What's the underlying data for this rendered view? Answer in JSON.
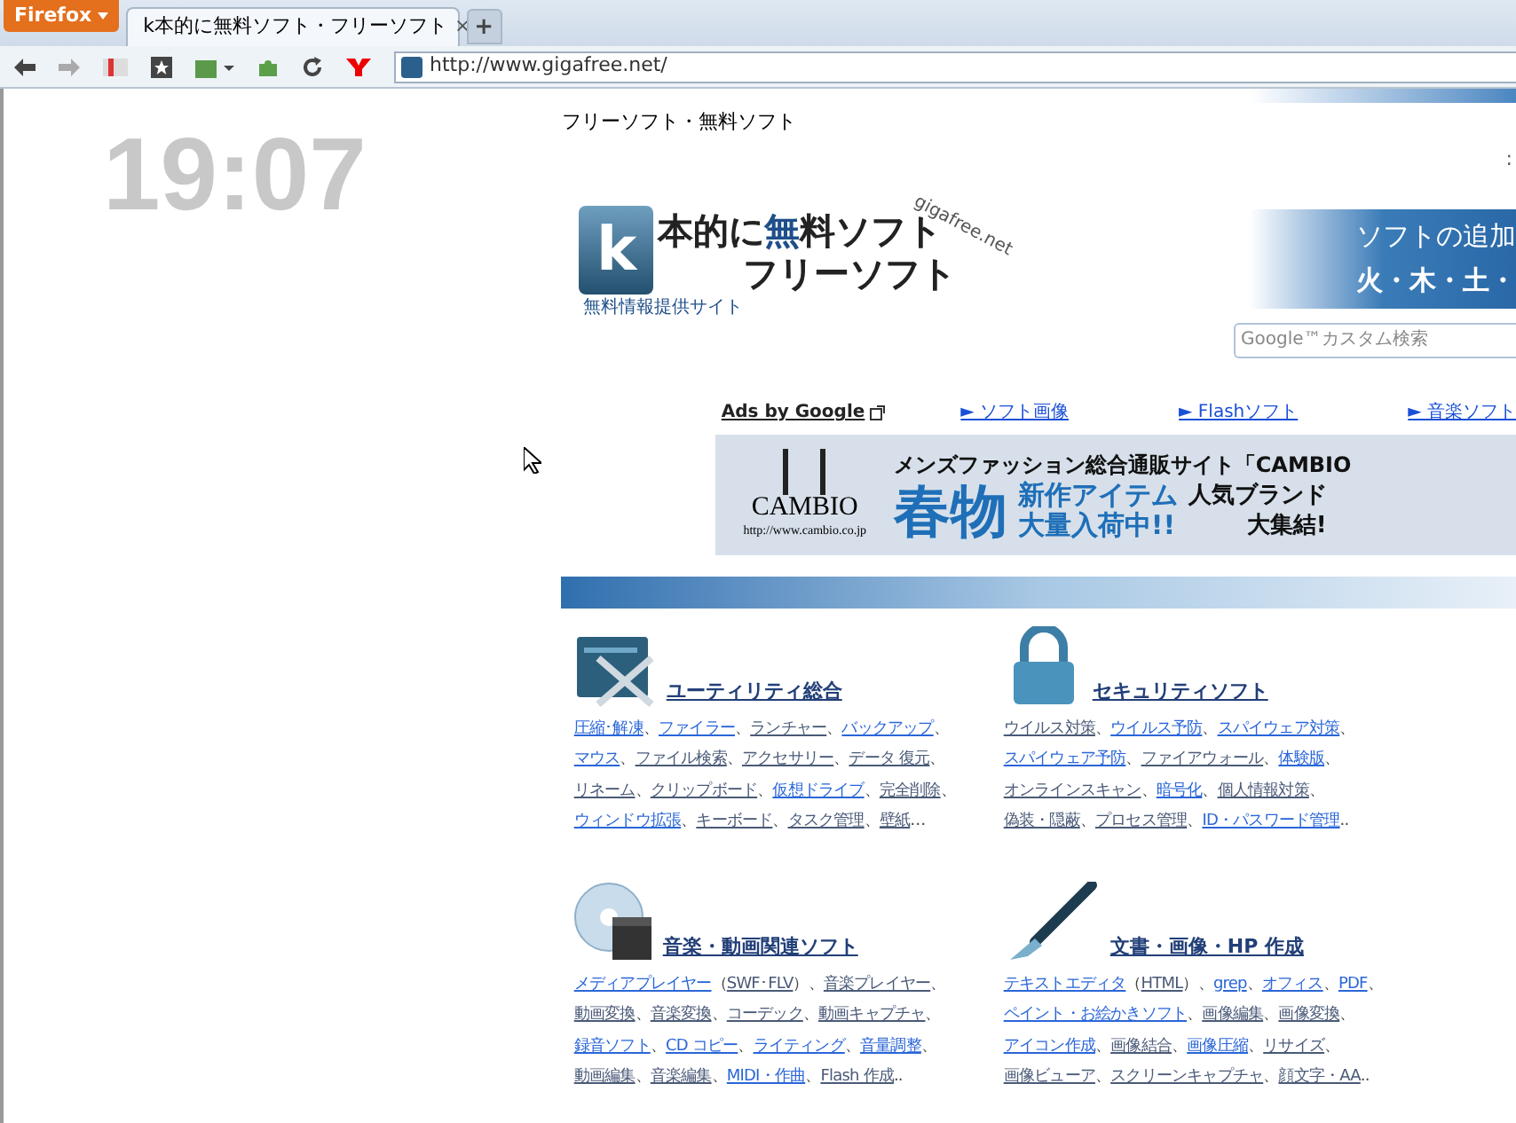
{
  "browser": {
    "menu_button": "Firefox",
    "tabs": [
      {
        "title": "k本的に無料ソフト・フリーソフト",
        "selected": true,
        "close": "×"
      }
    ],
    "new_tab": "+",
    "address": "http://www.gigafree.net/"
  },
  "clock": {
    "time": "19:07"
  },
  "page": {
    "title": "フリーソフト・無料ソフト",
    "edge_fragment": ":",
    "logo": {
      "line_1_k": "k",
      "line_1": "本的に",
      "line_1_accent": "無",
      "line_1_rest": "料ソフト",
      "line_2": "フリーソフト",
      "tagline": "無料情報提供サイト",
      "domain": "gigafree.net"
    },
    "banner": {
      "line_1": "ソフトの追加",
      "line_2": "火・木・土・"
    },
    "search": {
      "placeholder": "Google™カスタム検索"
    },
    "ads_label": "Ads by Google",
    "ad_links": [
      "► ソフト画像",
      "► Flashソフト",
      "► 音楽ソフト"
    ],
    "ad_banner": {
      "logo_text": "CAMBIO",
      "logo_url": "http://www.cambio.co.jp",
      "headline": "メンズファッション総合通販サイト「CAMBIO",
      "big": "春物",
      "line_a1": "新作アイテム",
      "line_a2": "大量入荷中!!",
      "line_b1": "人気ブランド",
      "line_b2": "大集結!"
    },
    "categories": [
      {
        "kind": "tools",
        "title": "ユーティリティ総合",
        "lines": [
          [
            {
              "text": "圧縮･解凍",
              "sep": "、",
              "visited": false
            },
            {
              "text": "ファイラー",
              "sep": "、",
              "visited": false
            },
            {
              "text": "ランチャー",
              "sep": "、",
              "visited": true
            },
            {
              "text": "バックアップ",
              "sep": "、",
              "visited": false
            }
          ],
          [
            {
              "text": "マウス",
              "sep": "、",
              "visited": false
            },
            {
              "text": "ファイル検索",
              "sep": "、",
              "visited": true
            },
            {
              "text": "アクセサリー",
              "sep": "、",
              "visited": true
            },
            {
              "text": "データ 復元",
              "sep": "、",
              "visited": true
            }
          ],
          [
            {
              "text": "リネーム",
              "sep": "、",
              "visited": true
            },
            {
              "text": "クリップボード",
              "sep": "、",
              "visited": true
            },
            {
              "text": "仮想ドライブ",
              "sep": "、",
              "visited": false
            },
            {
              "text": "完全削除",
              "sep": "、",
              "visited": true
            }
          ],
          [
            {
              "text": "ウィンドウ拡張",
              "sep": "、",
              "visited": false
            },
            {
              "text": "キーボード",
              "sep": "、",
              "visited": true
            },
            {
              "text": "タスク管理",
              "sep": "、",
              "visited": true
            },
            {
              "text": "壁紙",
              "sep": "…",
              "visited": true
            }
          ]
        ]
      },
      {
        "kind": "lock",
        "title": "セキュリティソフト",
        "lines": [
          [
            {
              "text": "ウイルス対策",
              "sep": "、",
              "visited": true
            },
            {
              "text": "ウイルス予防",
              "sep": "、",
              "visited": false
            },
            {
              "text": "スパイウェア対策",
              "sep": "、",
              "visited": false
            }
          ],
          [
            {
              "text": "スパイウェア予防",
              "sep": "、",
              "visited": false
            },
            {
              "text": "ファイアウォール",
              "sep": "、",
              "visited": true
            },
            {
              "text": "体験版",
              "sep": "、",
              "visited": false
            }
          ],
          [
            {
              "text": "オンラインスキャン",
              "sep": "、",
              "visited": true
            },
            {
              "text": "暗号化",
              "sep": "、",
              "visited": false
            },
            {
              "text": "個人情報対策",
              "sep": "、",
              "visited": true
            }
          ],
          [
            {
              "text": "偽装・隠蔽",
              "sep": "、",
              "visited": true
            },
            {
              "text": "プロセス管理",
              "sep": "、",
              "visited": true
            },
            {
              "text": "ID・パスワード管理",
              "sep": "..",
              "visited": false
            }
          ]
        ]
      },
      {
        "kind": "media",
        "title": "音楽・動画関連ソフト",
        "lines": [
          [
            {
              "text": "メディアプレイヤー",
              "sep": "（",
              "visited": false
            },
            {
              "text": "SWF･FLV",
              "sep": "）、",
              "visited": true
            },
            {
              "text": "音楽プレイヤー",
              "sep": "、",
              "visited": true
            }
          ],
          [
            {
              "text": "動画変換",
              "sep": "、",
              "visited": true
            },
            {
              "text": "音楽変換",
              "sep": "、",
              "visited": true
            },
            {
              "text": "コーデック",
              "sep": "、",
              "visited": true
            },
            {
              "text": "動画キャプチャ",
              "sep": "、",
              "visited": true
            }
          ],
          [
            {
              "text": "録音ソフト",
              "sep": "、",
              "visited": false
            },
            {
              "text": "CD コピー",
              "sep": "、",
              "visited": false
            },
            {
              "text": "ライティング",
              "sep": "、",
              "visited": false
            },
            {
              "text": "音量調整",
              "sep": "、",
              "visited": false
            }
          ],
          [
            {
              "text": "動画編集",
              "sep": "、",
              "visited": true
            },
            {
              "text": "音楽編集",
              "sep": "、",
              "visited": true
            },
            {
              "text": "MIDI・作曲",
              "sep": "、",
              "visited": false
            },
            {
              "text": "Flash 作成",
              "sep": "..",
              "visited": true
            }
          ]
        ]
      },
      {
        "kind": "brush",
        "title": "文書・画像・HP 作成",
        "lines": [
          [
            {
              "text": "テキストエディタ",
              "sep": "（",
              "visited": false
            },
            {
              "text": "HTML",
              "sep": "）、",
              "visited": true
            },
            {
              "text": "grep",
              "sep": "、",
              "visited": false
            },
            {
              "text": "オフィス",
              "sep": "、",
              "visited": false
            },
            {
              "text": "PDF",
              "sep": "、",
              "visited": false
            }
          ],
          [
            {
              "text": "ペイント・お絵かきソフト",
              "sep": "、",
              "visited": false
            },
            {
              "text": "画像編集",
              "sep": "、",
              "visited": true
            },
            {
              "text": "画像変換",
              "sep": "、",
              "visited": true
            }
          ],
          [
            {
              "text": "アイコン作成",
              "sep": "、",
              "visited": false
            },
            {
              "text": "画像結合",
              "sep": "、",
              "visited": true
            },
            {
              "text": "画像圧縮",
              "sep": "、",
              "visited": false
            },
            {
              "text": "リサイズ",
              "sep": "、",
              "visited": true
            }
          ],
          [
            {
              "text": "画像ビューア",
              "sep": "、",
              "visited": true
            },
            {
              "text": "スクリーンキャプチャ",
              "sep": "、",
              "visited": true
            },
            {
              "text": "顔文字・AA",
              "sep": "..",
              "visited": true
            }
          ]
        ]
      }
    ]
  }
}
